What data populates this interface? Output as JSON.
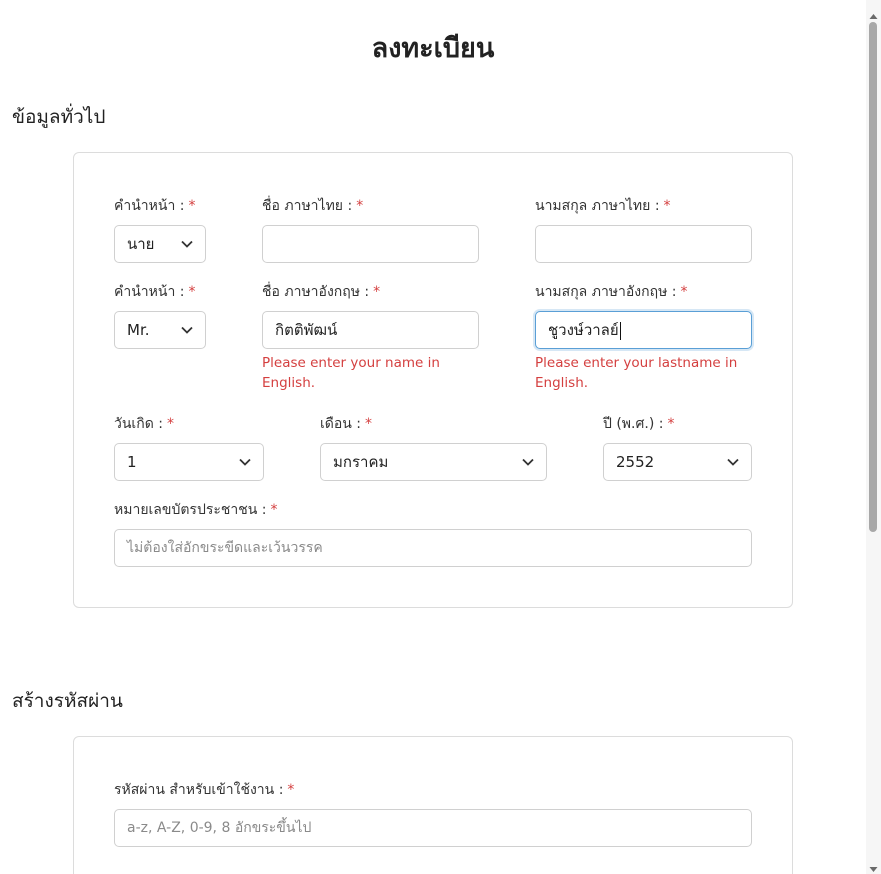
{
  "page_title": "ลงทะเบียน",
  "required_mark": "*",
  "section_general": {
    "title": "ข้อมูลทั่วไป",
    "prefix_th_label": "คำนำหน้า :",
    "prefix_th_value": "นาย",
    "firstname_th_label": "ชื่อ ภาษาไทย :",
    "firstname_th_value": "",
    "lastname_th_label": "นามสกุล ภาษาไทย :",
    "lastname_th_value": "",
    "prefix_en_label": "คำนำหน้า :",
    "prefix_en_value": "Mr.",
    "firstname_en_label": "ชื่อ ภาษาอังกฤษ :",
    "firstname_en_value": "กิตติพัฒน์",
    "firstname_en_error": "Please enter your name in English.",
    "lastname_en_label": "นามสกุล ภาษาอังกฤษ :",
    "lastname_en_value": "ชูวงษ์วาลย์",
    "lastname_en_error": "Please enter your lastname in English.",
    "birth_day_label": "วันเกิด :",
    "birth_day_value": "1",
    "birth_month_label": "เดือน :",
    "birth_month_value": "มกราคม",
    "birth_year_label": "ปี (พ.ศ.) :",
    "birth_year_value": "2552",
    "id_card_label": "หมายเลขบัตรประชาชน :",
    "id_card_placeholder": "ไม่ต้องใส่อักขระขีดและเว้นวรรค"
  },
  "section_password": {
    "title": "สร้างรหัสผ่าน",
    "password_label": "รหัสผ่าน สำหรับเข้าใช้งาน :",
    "password_placeholder": "a-z, A-Z, 0-9, 8 อักขระขึ้นไป"
  },
  "colors": {
    "required": "#d43f3f",
    "error": "#d43f3f",
    "focus_border": "#5a9fd6"
  },
  "icons": {
    "select_arrow": "chevron-down-icon"
  }
}
